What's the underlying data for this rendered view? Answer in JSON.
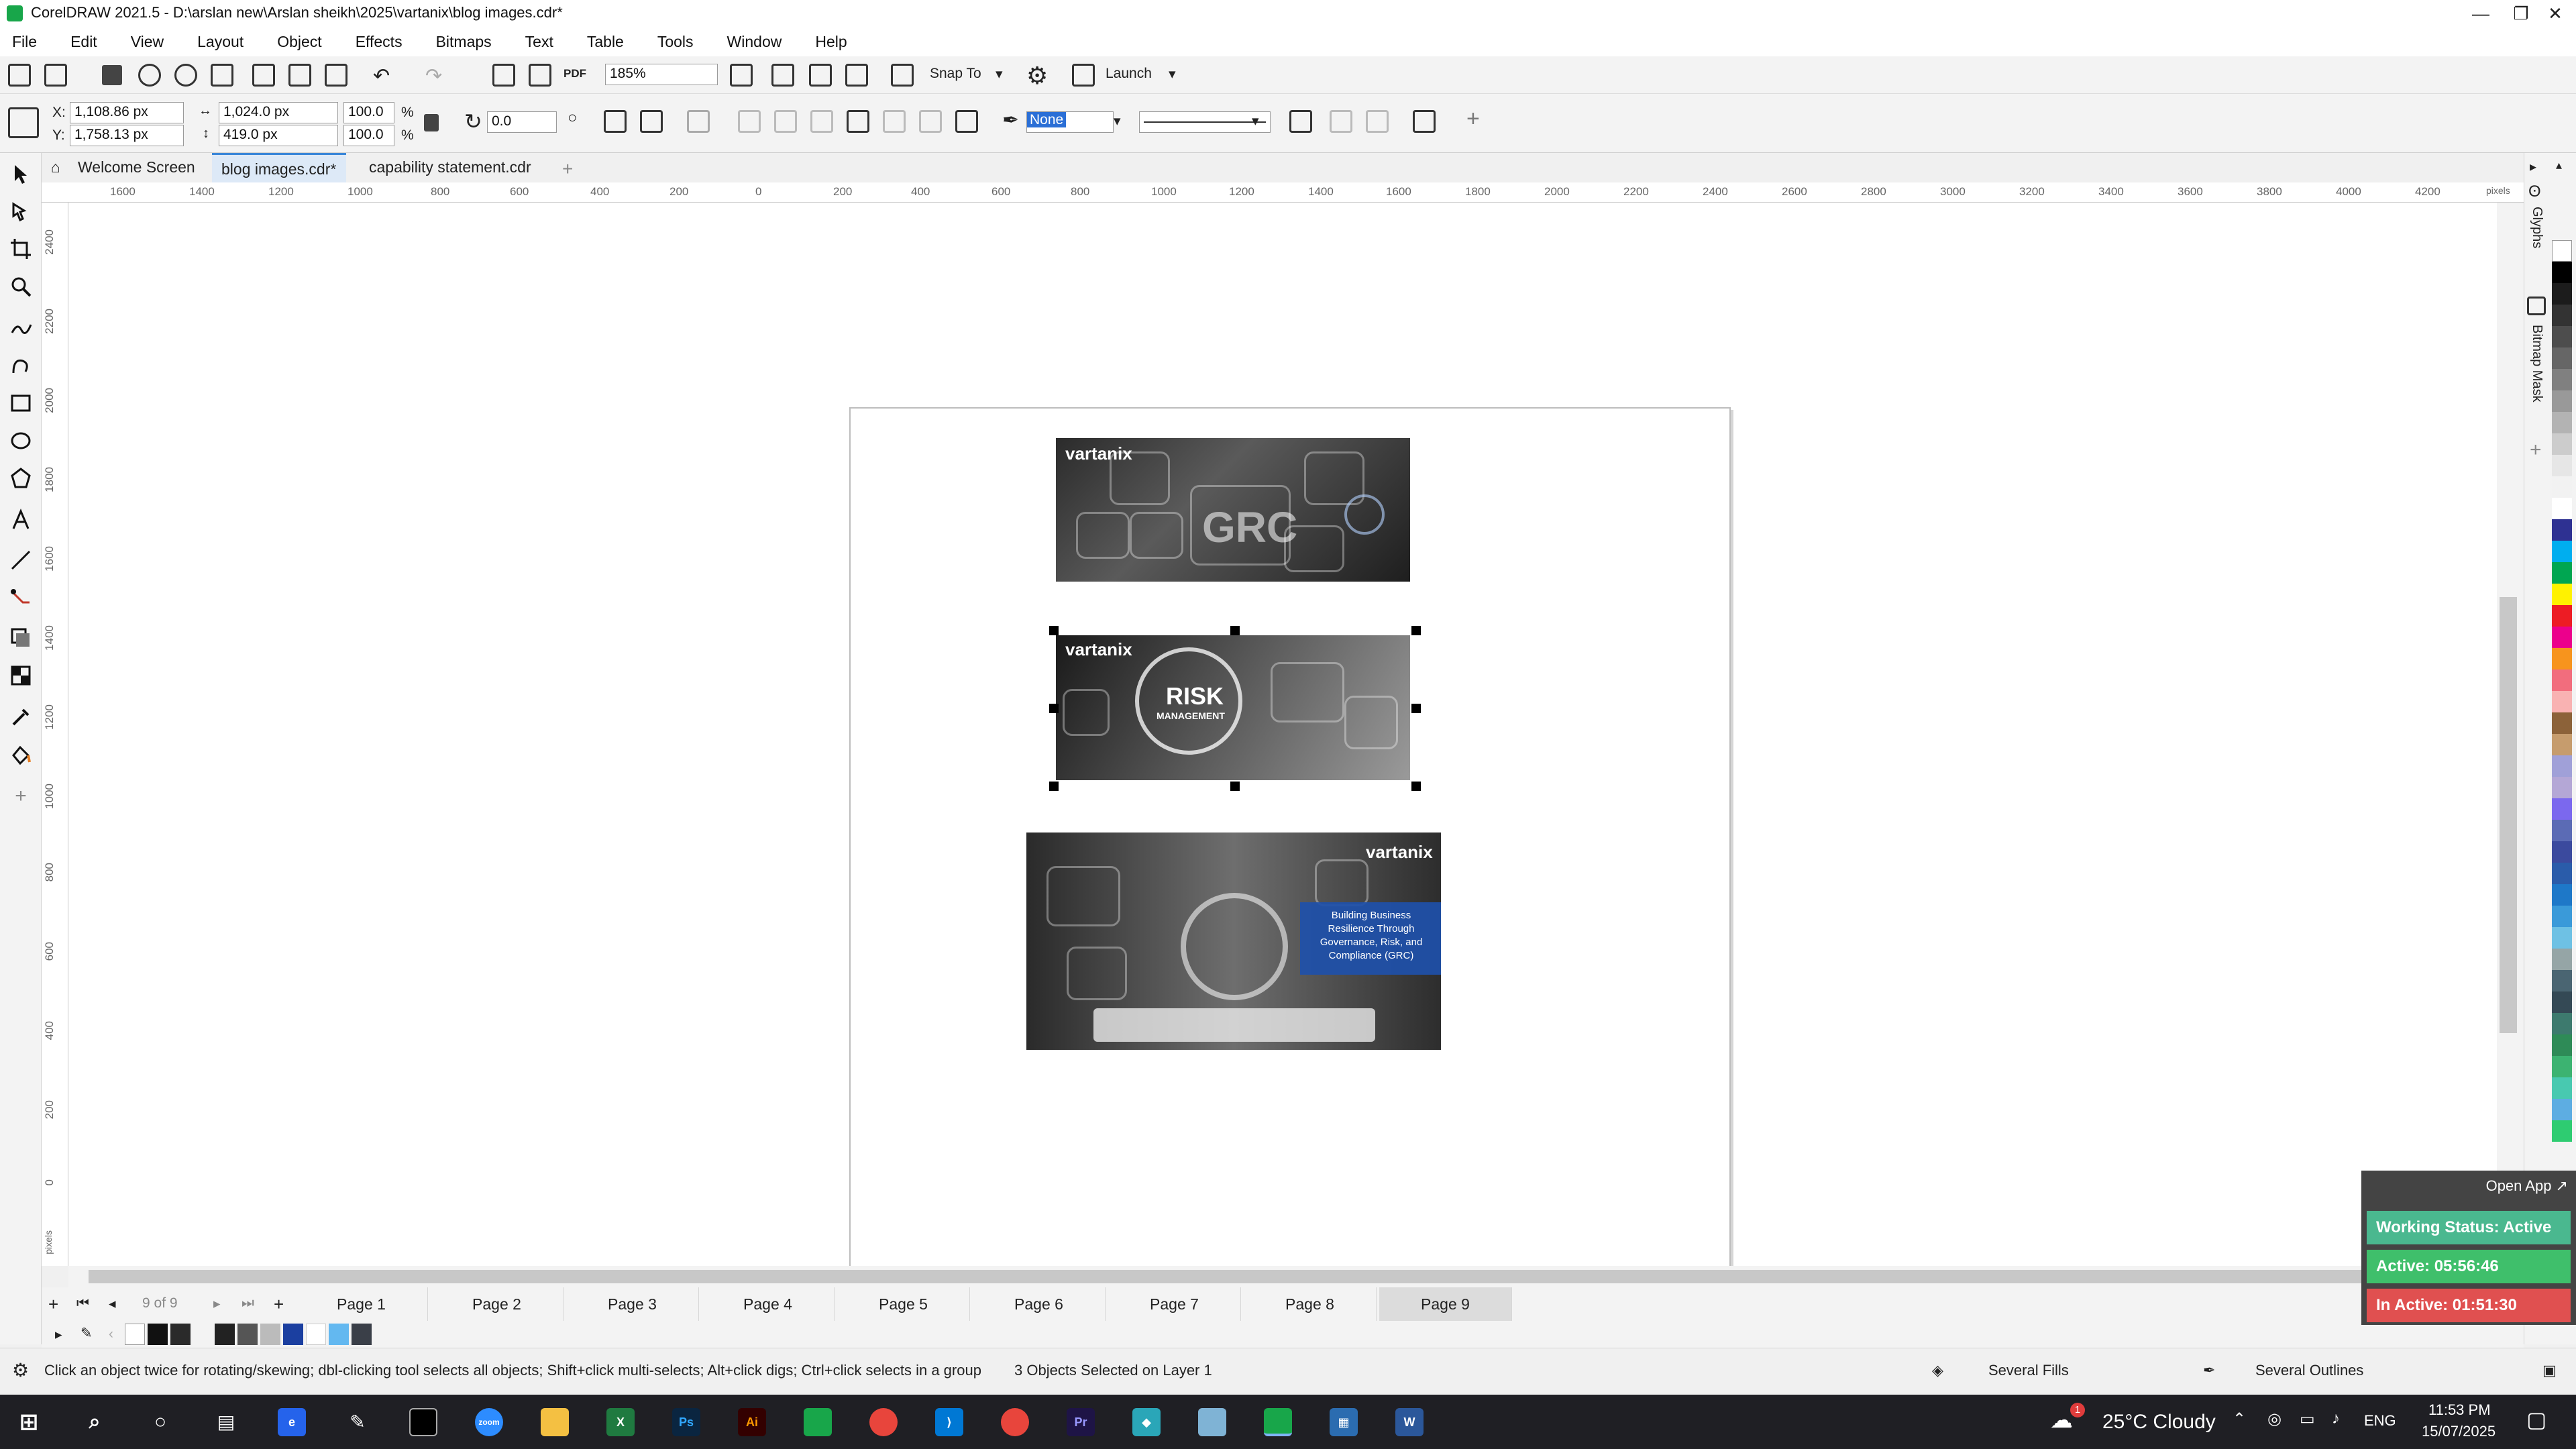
{
  "window": {
    "title": "CorelDRAW 2021.5 - D:\\arslan new\\Arslan sheikh\\2025\\vartanix\\blog images.cdr*",
    "minimize": "—",
    "maximize": "❐",
    "close": "✕"
  },
  "menu": [
    "File",
    "Edit",
    "View",
    "Layout",
    "Object",
    "Effects",
    "Bitmaps",
    "Text",
    "Table",
    "Tools",
    "Window",
    "Help"
  ],
  "toolbar": {
    "zoom": "185%",
    "snap_to": "Snap To",
    "launch": "Launch",
    "pdf": "PDF"
  },
  "properties": {
    "x": "1,108.86 px",
    "y": "1,758.13 px",
    "width": "1,024.0 px",
    "height": "419.0 px",
    "scale_x": "100.0",
    "scale_y": "100.0",
    "percent": "%",
    "rotation": "0.0",
    "outline": "None",
    "x_label": "X:",
    "y_label": "Y:"
  },
  "tabs": [
    {
      "label": "Welcome Screen"
    },
    {
      "label": "blog images.cdr*"
    },
    {
      "label": "capability statement.cdr"
    }
  ],
  "ruler_h": [
    "1600",
    "1400",
    "1200",
    "1000",
    "800",
    "600",
    "400",
    "200",
    "0",
    "200",
    "400",
    "600",
    "800",
    "1000",
    "1200",
    "1400",
    "1600",
    "1800",
    "2000",
    "2200",
    "2400",
    "2600",
    "2800",
    "3000",
    "3200",
    "3400",
    "3600",
    "3800",
    "4000",
    "4200",
    "pixels"
  ],
  "ruler_v": [
    "2400",
    "2200",
    "2000",
    "1800",
    "1600",
    "1400",
    "1200",
    "1000",
    "800",
    "600",
    "400",
    "200",
    "0",
    "pixels"
  ],
  "images": {
    "img1_logo": "vartanix",
    "img1_text": "GRC",
    "img2_logo": "vartanix",
    "img2_text": "RISK",
    "img2_sub": "MANAGEMENT",
    "img3_logo": "vartanix",
    "img3_caption": "Building Business Resilience Through Governance, Risk, and Compliance (GRC)"
  },
  "dockers": {
    "glyphs": "Glyphs",
    "bitmap_mask": "Bitmap Mask"
  },
  "pages": {
    "counter": "9 of 9",
    "list": [
      "Page 1",
      "Page 2",
      "Page 3",
      "Page 4",
      "Page 5",
      "Page 6",
      "Page 7",
      "Page 8",
      "Page 9"
    ]
  },
  "status": {
    "hint": "Click an object twice for rotating/skewing; dbl-clicking tool selects all objects; Shift+click multi-selects; Alt+click digs; Ctrl+click selects in a group",
    "selection": "3 Objects Selected on Layer 1",
    "fills": "Several Fills",
    "outlines": "Several Outlines"
  },
  "work_status": {
    "open_app": "Open App ↗",
    "working": "Working Status: Active",
    "active": "Active: 05:56:46",
    "inactive": "In Active: 01:51:30"
  },
  "taskbar": {
    "weather": "25°C Cloudy",
    "lang": "ENG",
    "time": "11:53 PM",
    "date": "15/07/2025",
    "notif": "1"
  },
  "colors": {
    "accent": "#3a86d8",
    "active_green": "#3fbf6b",
    "inactive_red": "#e05050",
    "working_teal": "#4ab88f"
  }
}
